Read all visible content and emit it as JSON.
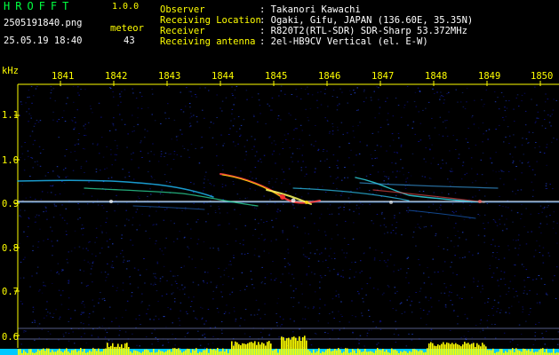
{
  "header": {
    "app_title": "HROFFT",
    "app_version": "1.0.0",
    "filename": "2505191840.png",
    "datetime": "25.05.19 18:40",
    "meteor_label": "meteor",
    "meteor_count": "43",
    "info": [
      {
        "label": "Observer",
        "value": ": Takanori Kawachi"
      },
      {
        "label": "Receiving Location",
        "value": ": Ogaki, Gifu, JAPAN (136.60E, 35.35N)"
      },
      {
        "label": "Receiver",
        "value": ": R820T2(RTL-SDR) SDR-Sharp 53.372MHz"
      },
      {
        "label": "Receiving antenna",
        "value": ": 2el-HB9CV Vertical (el. E-W)"
      }
    ]
  },
  "axes": {
    "y_unit": "kHz",
    "x_ticks": [
      "1841",
      "1842",
      "1843",
      "1844",
      "1845",
      "1846",
      "1847",
      "1848",
      "1849",
      "1850"
    ],
    "y_ticks": [
      "1.1",
      "1.0",
      "0.9",
      "0.8",
      "0.7",
      "0.6"
    ]
  },
  "colors": {
    "background": "#000000",
    "axis_text": "#ffff00",
    "noise": "#0a0a6a",
    "carrier": "#ffffff",
    "level_bar": "#ffff00",
    "level_base": "#00c8ff"
  }
}
